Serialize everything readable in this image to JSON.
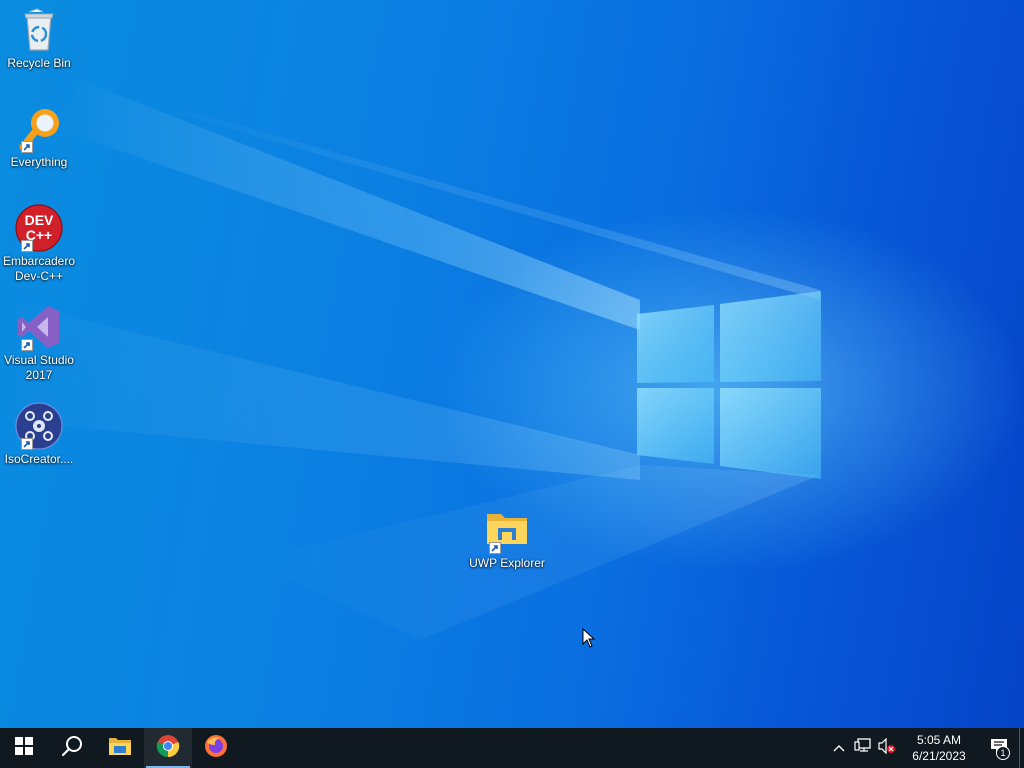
{
  "desktop": {
    "icons": [
      {
        "label": "Recycle Bin",
        "icon": "recycle-bin-icon",
        "shortcut": false
      },
      {
        "label": "Everything",
        "icon": "everything-search-icon",
        "shortcut": true
      },
      {
        "label": "Embarcadero\nDev-C++",
        "icon": "dev-cpp-icon",
        "shortcut": true
      },
      {
        "label": "Visual Studio\n2017",
        "icon": "visual-studio-icon",
        "shortcut": true
      },
      {
        "label": "IsoCreator....",
        "icon": "isocreator-icon",
        "shortcut": true
      },
      {
        "label": "UWP Explorer",
        "icon": "folder-icon",
        "shortcut": true
      }
    ],
    "dev_cpp_badge_line1": "DEV",
    "dev_cpp_badge_line2": "C++"
  },
  "taskbar": {
    "items": [
      {
        "name": "start",
        "icon": "windows-logo-icon"
      },
      {
        "name": "search",
        "icon": "search-icon"
      },
      {
        "name": "file-explorer",
        "icon": "file-explorer-icon"
      },
      {
        "name": "chrome",
        "icon": "chrome-icon",
        "active": true
      },
      {
        "name": "firefox",
        "icon": "firefox-icon"
      }
    ],
    "tray": {
      "icons": [
        "chevron-up-icon",
        "network-icon",
        "volume-muted-icon"
      ],
      "time": "5:05 AM",
      "date": "6/21/2023",
      "notification_count": "1"
    }
  },
  "colors": {
    "taskbar": "#101820",
    "desktop_accent": "#0a78dc"
  }
}
